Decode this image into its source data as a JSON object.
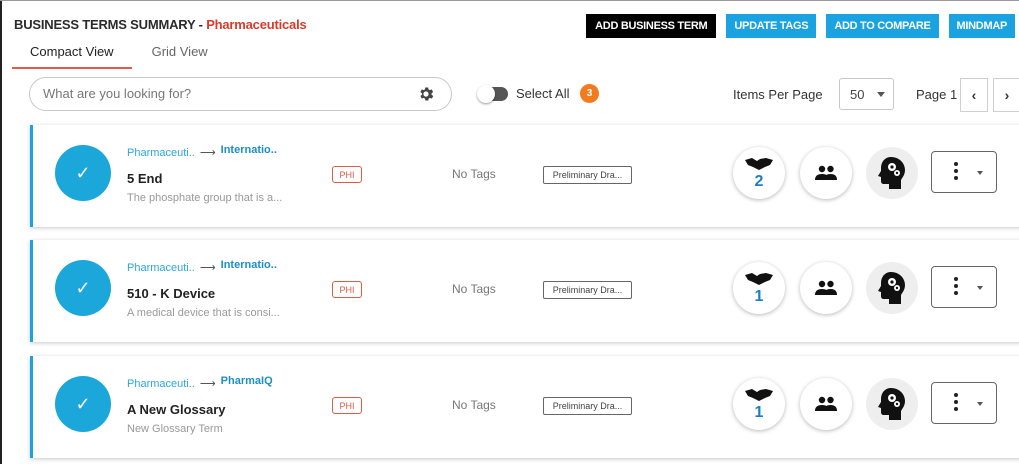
{
  "header": {
    "prefix": "BUSINESS TERMS SUMMARY - ",
    "domain": "Pharmaceuticals"
  },
  "toolbar": {
    "add_business_term": "ADD BUSINESS TERM",
    "update_tags": "UPDATE TAGS",
    "add_to_compare": "ADD TO COMPARE",
    "mindmap": "MINDMAP"
  },
  "tabs": [
    {
      "label": "Compact View",
      "active": true
    },
    {
      "label": "Grid View",
      "active": false
    }
  ],
  "search": {
    "placeholder": "What are you looking for?"
  },
  "select_all": {
    "label": "Select All",
    "count": "3"
  },
  "pagination": {
    "items_per_page_label": "Items Per Page",
    "items_per_page": "50",
    "page_label": "Page 1",
    "prev": "‹",
    "next": "›"
  },
  "terms": [
    {
      "crumb_parent": "Pharmaceuti..",
      "crumb_child": "Internatio..",
      "title": "5 End",
      "description": "The phosphate group that is a...",
      "classification": "PHI",
      "tags": "No Tags",
      "status": "Preliminary Dra...",
      "handshake_count": "2",
      "selected": true
    },
    {
      "crumb_parent": "Pharmaceuti..",
      "crumb_child": "Internatio..",
      "title": "510 - K Device",
      "description": "A medical device that is consi...",
      "classification": "PHI",
      "tags": "No Tags",
      "status": "Preliminary Dra...",
      "handshake_count": "1",
      "selected": true
    },
    {
      "crumb_parent": "Pharmaceuti..",
      "crumb_child": "PharmaIQ",
      "title": "A New Glossary",
      "description": "New Glossary Term",
      "classification": "PHI",
      "tags": "No Tags",
      "status": "Preliminary Dra...",
      "handshake_count": "1",
      "selected": true
    }
  ],
  "colors": {
    "accent": "#1aa3e0",
    "brand_red": "#d93a2b",
    "badge_orange": "#f27b1e",
    "check_blue": "#1ba7da"
  },
  "icons": [
    "gear-icon",
    "checkmark-icon",
    "arrow-right-icon",
    "handshake-icon",
    "users-icon",
    "brain-gears-icon",
    "more-vertical-icon",
    "chevron-down-icon"
  ]
}
